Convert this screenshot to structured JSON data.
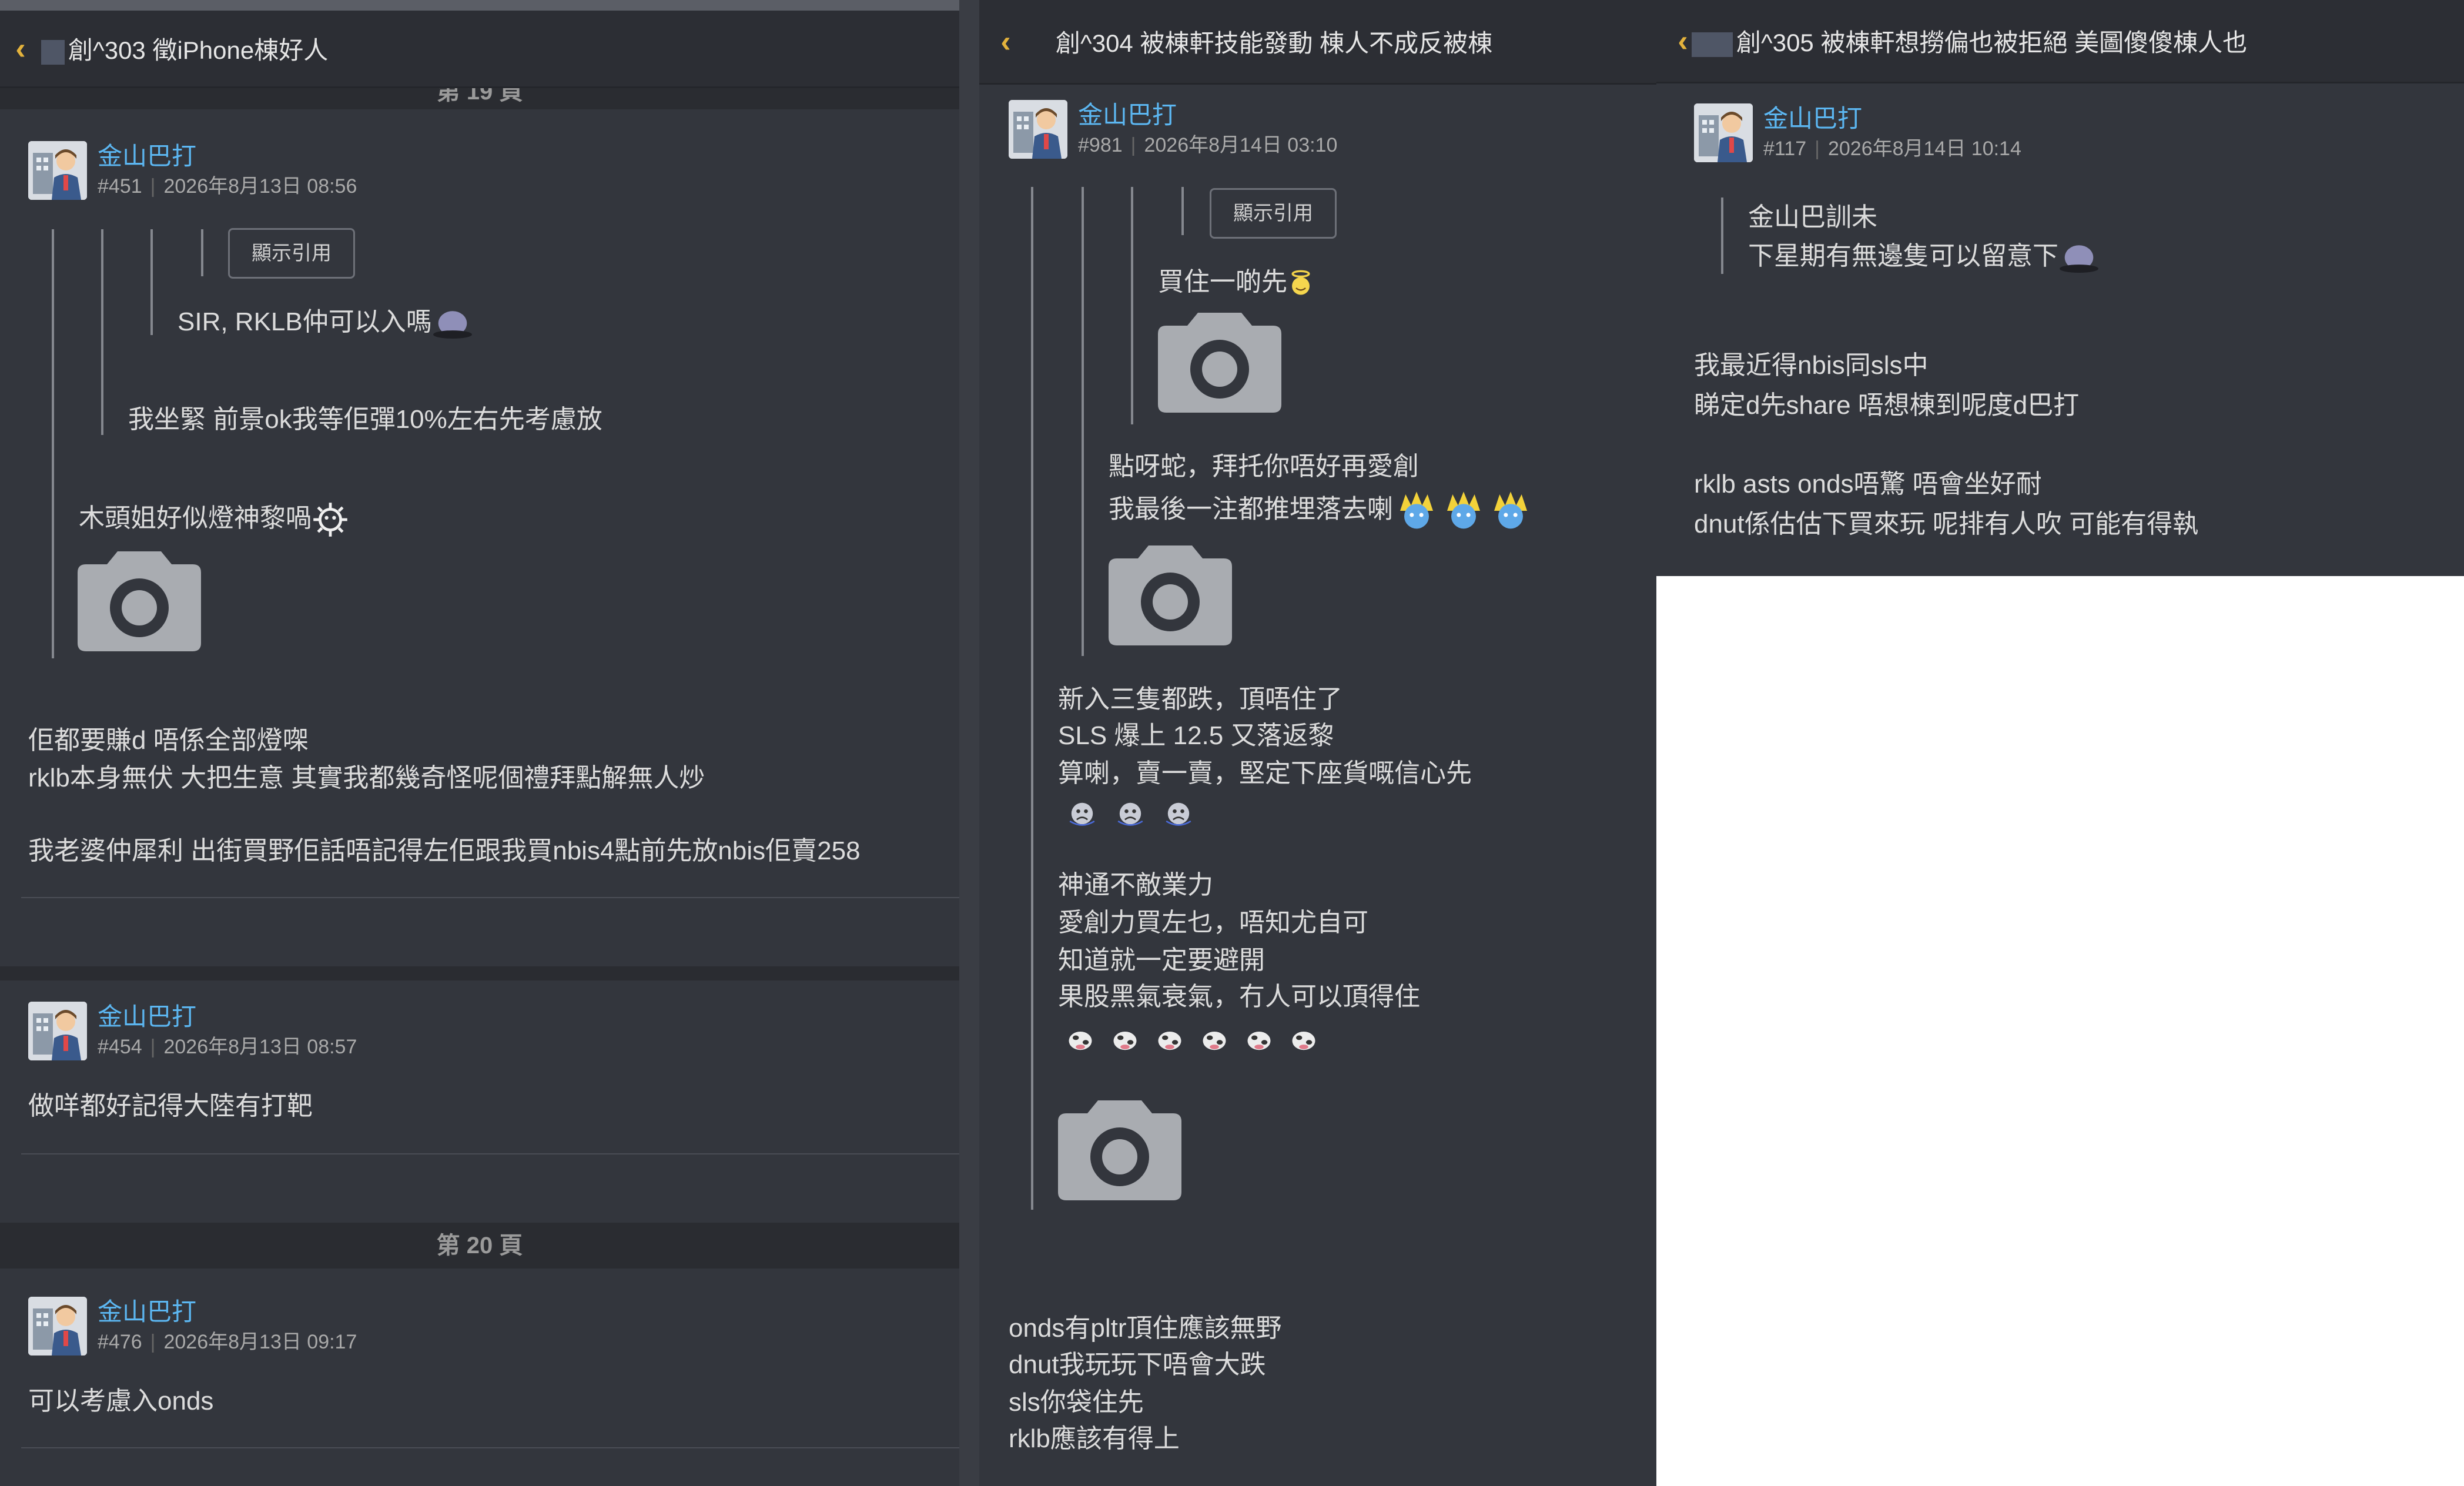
{
  "panel1": {
    "title": "創^303 徵iPhone棟好人",
    "page19_label": "第 19 頁",
    "page20_label": "第 20 頁",
    "quote_button": "顯示引用",
    "post451": {
      "author": "金山巴打",
      "number": "#451",
      "date": "2026年8月13日 08:56",
      "quote1": "SIR, RKLB仲可以入嗎",
      "quote2": "我坐緊 前景ok我等佢彈10%左右先考慮放",
      "quote3": "木頭姐好似燈神黎喎",
      "line1": "佢都要賺d 唔係全部燈㗎",
      "line2": "rklb本身無伏 大把生意 其實我都幾奇怪呢個禮拜點解無人炒",
      "line3": "我老婆仲犀利 出街買野佢話唔記得左佢跟我買nbis4點前先放nbis佢賣258"
    },
    "post454": {
      "author": "金山巴打",
      "number": "#454",
      "date": "2026年8月13日 08:57",
      "line1": "做咩都好記得大陸有打靶"
    },
    "post476": {
      "author": "金山巴打",
      "number": "#476",
      "date": "2026年8月13日 09:17",
      "line1": "可以考慮入onds"
    }
  },
  "panel2": {
    "title": "創^304 被棟軒技能發動 棟人不成反被棟",
    "quote_button": "顯示引用",
    "post981": {
      "author": "金山巴打",
      "number": "#981",
      "date": "2026年8月14日 03:10",
      "quote1": "買住一啲先",
      "quote2a": "點呀蛇，拜托你唔好再愛創",
      "quote2b": "我最後一注都推埋落去喇",
      "q3_1": "新入三隻都跌，頂唔住了",
      "q3_2": "SLS 爆上 12.5 又落返黎",
      "q3_3": "算喇，賣一賣，堅定下座貨嘅信心先",
      "q3_5": "神通不敵業力",
      "q3_6": "愛創力買左乜，唔知尤自可",
      "q3_7": "知道就一定要避開",
      "q3_8": "果股黑氣衰氣，冇人可以頂得住",
      "line1": "onds有pltr頂住應該無野",
      "line2": "dnut我玩玩下唔會大跌",
      "line3": "sls你袋住先",
      "line4": "rklb應該有得上"
    }
  },
  "panel3": {
    "title": "創^305 被棟軒想撈偏也被拒絕 美圖傻傻棟人也",
    "post117": {
      "author": "金山巴打",
      "number": "#117",
      "date": "2026年8月14日 10:14",
      "quote1": "金山巴訓未",
      "quote2": "下星期有無邊隻可以留意下",
      "line1": "我最近得nbis同sls中",
      "line2": "睇定d先share 唔想棟到呢度d巴打",
      "line3": "rklb asts onds唔驚 唔會坐好耐",
      "line4": "dnut係估估下買來玩 呢排有人吹 可能有得執"
    }
  },
  "colors": {
    "background": "#33363d",
    "author": "#5cb7f2",
    "back_arrow": "#e3b23c",
    "text": "#dcdcdc"
  },
  "icons": {
    "back": "chevron-left-icon",
    "camera": "camera-icon",
    "avatar": "avatar-image"
  }
}
